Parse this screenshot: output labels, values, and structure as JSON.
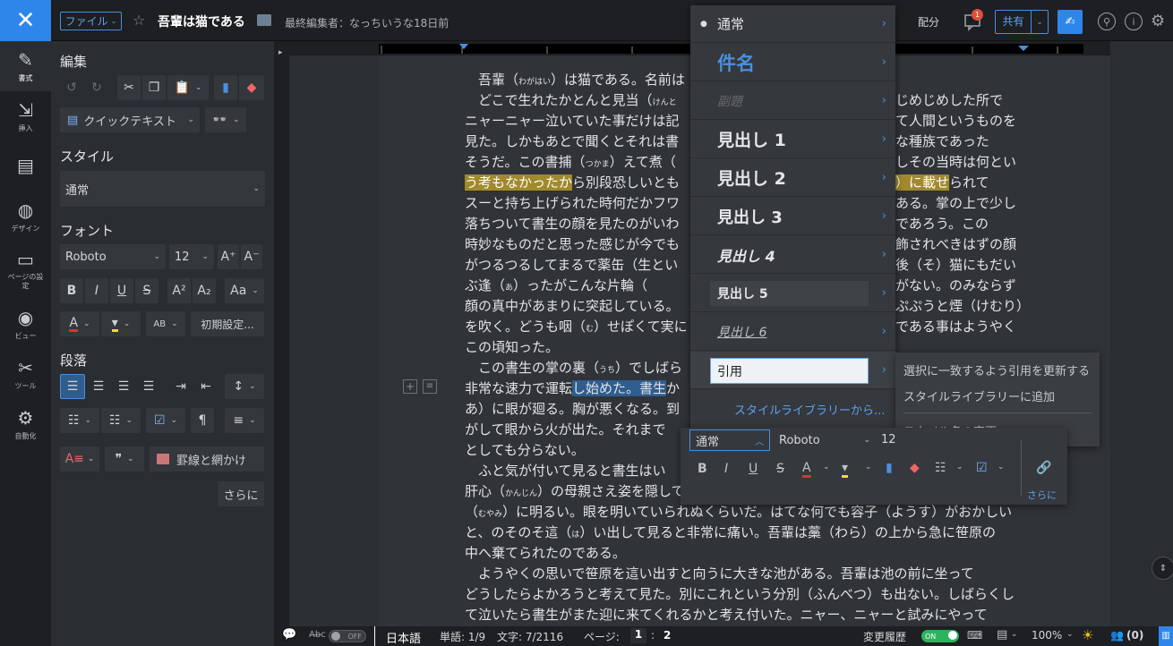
{
  "topbar": {
    "close_glyph": "✕",
    "file_label": "ファイル",
    "doc_title": "吾輩は猫である",
    "last_edit": "最終編集者：なっちいうな18日前",
    "distribute_label": "配分",
    "comment_badge": "1",
    "share_label": "共有"
  },
  "rail": [
    {
      "label": "書式",
      "icon": "format-icon"
    },
    {
      "label": "挿入",
      "icon": "insert-icon"
    },
    {
      "label": "",
      "icon": "document-icon"
    },
    {
      "label": "デザイン",
      "icon": "palette-icon"
    },
    {
      "label": "ページの設定",
      "icon": "page-setup-icon"
    },
    {
      "label": "ビュー",
      "icon": "eye-icon"
    },
    {
      "label": "ツール",
      "icon": "tools-icon"
    },
    {
      "label": "自動化",
      "icon": "automation-icon"
    }
  ],
  "panel": {
    "edit_title": "編集",
    "quick_text": "クイックテキスト",
    "style_title": "スタイル",
    "style_value": "通常",
    "font_title": "フォント",
    "font_name": "Roboto",
    "font_size": "12",
    "reset_label": "初期設定...",
    "para_title": "段落",
    "borders_label": "罫線と網かけ",
    "more_label": "さらに"
  },
  "document": {
    "lines": [
      {
        "pre": "　吾輩（",
        "ruby": "わがはい",
        "post": "）は猫である。名前は"
      },
      {
        "pre": "　どこで生れたかとんと見当（",
        "ruby": "けんと",
        "post": ""
      },
      {
        "pre": "ニャーニャー泣いていた事だけは記",
        "ruby": "",
        "post": ""
      },
      {
        "pre": "見た。しかもあとで聞くとそれは書",
        "ruby": "",
        "post": ""
      },
      {
        "pre": "そうだ。この書捕（",
        "ruby": "つかま",
        "post": "）えて煮（"
      },
      {
        "pre": "",
        "hl": "う考もなかったか",
        "post": "ら別段恐しいとも"
      },
      {
        "pre": "スーと持ち上げられた時何だかフワ",
        "ruby": "",
        "post": ""
      },
      {
        "pre": "落ちついて書生の顔を見たのがいわ",
        "ruby": "",
        "post": ""
      },
      {
        "pre": "時妙なものだと思った感じが今でも",
        "ruby": "",
        "post": ""
      },
      {
        "pre": "がつるつるしてまるで薬缶（生とい",
        "ruby": "",
        "post": ""
      },
      {
        "pre": "ぶ逢（",
        "ruby": "あ",
        "post": "）ったがこんな片輪（"
      },
      {
        "pre": "顔の真中があまりに突起している。",
        "ruby": "",
        "post": ""
      },
      {
        "pre": "を吹く。どうも咽（",
        "ruby": "む",
        "post": "）せぽくて実に"
      },
      {
        "pre": "この頃知った。",
        "ruby": "",
        "post": ""
      },
      {
        "pre": "　この書生の掌の裏（",
        "ruby": "うち",
        "post": "）でしばら"
      },
      {
        "pre": "非常な速力で運転",
        "hlb": "し始めた。書生",
        "post": "か"
      },
      {
        "pre": "あ",
        "ruby": "",
        "post": "）に眼が廻る。胸が悪くなる。到"
      },
      {
        "pre": "がして眼から火が出た。それまで",
        "ruby": "",
        "post": ""
      },
      {
        "pre": "としても分らない。",
        "ruby": "",
        "post": ""
      },
      {
        "pre": "　ふと気が付いて見ると書生はい",
        "ruby": "",
        "post": ""
      },
      {
        "pre": "肝心（",
        "ruby": "かんじん",
        "post": "）の母親さえ姿を隠してしまった。その上今（いま）までの所とは違って無闇"
      },
      {
        "pre": "（",
        "ruby": "むやみ",
        "post": "）に明るい。眼を明いていられぬくらいだ。はてな何でも容子（ようす）がおかしい"
      },
      {
        "pre": "と、のそのそ這（",
        "ruby": "は",
        "post": "）い出して見ると非常に痛い。吾輩は藁（わら）の上から急に笹原の"
      },
      {
        "pre": "中へ棄てられたのである。",
        "ruby": "",
        "post": ""
      },
      {
        "pre": "　ようやくの思いで笹原を這い出すと向うに大きな池がある。吾輩は池の前に坐って",
        "ruby": "",
        "post": ""
      },
      {
        "pre": "どうしたらよかろうと考えて見た。別にこれという分別（ふんべつ）も出ない。しばらくし",
        "ruby": "",
        "post": ""
      },
      {
        "pre": "て泣いたら書生がまた迎に来てくれるかと考え付いた。ニャー、ニャーと試みにやって",
        "ruby": "",
        "post": ""
      }
    ],
    "right_fragments": [
      {
        "line": 1,
        "text": "じめじめした所で"
      },
      {
        "line": 2,
        "text": "て人間というものを"
      },
      {
        "line": 3,
        "text": "な種族であった"
      },
      {
        "line": 4,
        "text": "しその当時は何とい"
      },
      {
        "line": 5,
        "text": "）に載せ",
        "tail": "られて"
      },
      {
        "line": 6,
        "text": "ある。掌の上で少し"
      },
      {
        "line": 7,
        "text": "であろう。この"
      },
      {
        "line": 8,
        "text": "飾されべきはずの顔"
      },
      {
        "line": 9,
        "text": "後（そ）猫にもだい"
      },
      {
        "line": 10,
        "text": "がない。のみならず"
      },
      {
        "line": 11,
        "text": "ぷぷうと煙（けむり）"
      },
      {
        "line": 12,
        "text": "である事はようやく"
      }
    ]
  },
  "style_menu": {
    "items": [
      "通常",
      "件名",
      "副題",
      "見出し 1",
      "見出し 2",
      "見出し 3",
      "見出し 4",
      "見出し 5",
      "見出し 6",
      "引用"
    ],
    "library_link": "スタイルライブラリーから..."
  },
  "submenu": {
    "items": [
      "選択に一致するよう引用を更新する",
      "スタイルライブラリーに追加",
      "スタイル名の変更"
    ]
  },
  "minibar": {
    "style_value": "通常",
    "font_value": "Roboto",
    "size_value": "12",
    "more_label": "さらに"
  },
  "status": {
    "spell_toggle": "OFF",
    "language": "日本語",
    "words": "単語: 1/9",
    "chars": "文字: 7/2116",
    "page_label": "ページ:",
    "page_current": "1",
    "page_sep": ":",
    "page_total": "2",
    "history_label": "変更履歴",
    "history_toggle": "ON",
    "zoom": "100%",
    "users": "(0)"
  },
  "colors": {
    "accent": "#2f86ea",
    "highlight_yellow": "#a08a2b",
    "selection_blue": "#2f5d8f",
    "badge_red": "#e04e3a",
    "toggle_green": "#2db35d"
  }
}
